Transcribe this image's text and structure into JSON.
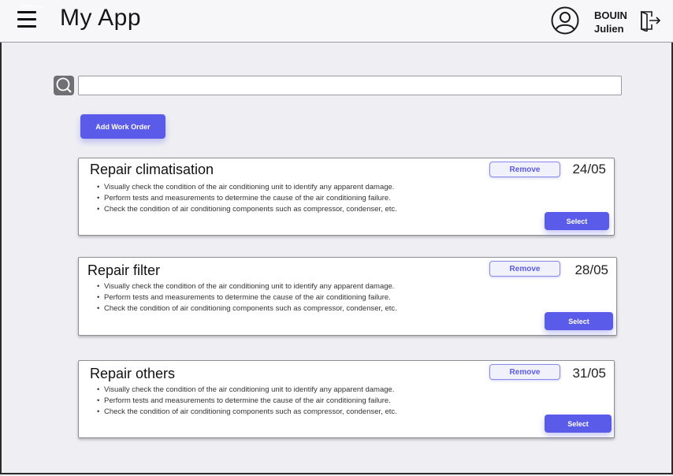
{
  "header": {
    "overlay_label": "Remove",
    "app_title": "My App",
    "user": {
      "last_name": "BOUIN",
      "first_name": "Julien"
    }
  },
  "search": {
    "value": "",
    "placeholder": ""
  },
  "actions": {
    "add_label": "Add Work Order"
  },
  "work_orders": [
    {
      "title": "Repair climatisation",
      "date": "24/05",
      "remove_label": "Remove",
      "select_label": "Select",
      "tasks": [
        "Visually check the condition of the air conditioning unit to identify any apparent damage.",
        "Perform tests and measurements to determine the cause of the air conditioning failure.",
        "Check the condition of air conditioning components such as compressor, condenser, etc."
      ]
    },
    {
      "title": "Repair filter",
      "date": "28/05",
      "remove_label": "Remove",
      "select_label": "Select",
      "tasks": [
        "Visually check the condition of the air conditioning unit to identify any apparent damage.",
        "Perform tests and measurements to determine the cause of the air conditioning failure.",
        "Check the condition of air conditioning components such as compressor, condenser, etc."
      ]
    },
    {
      "title": "Repair others",
      "date": "31/05",
      "remove_label": "Remove",
      "select_label": "Select",
      "tasks": [
        "Visually check the condition of the air conditioning unit to identify any apparent damage.",
        "Perform tests and measurements to determine the cause of the air conditioning failure.",
        "Check the condition of air conditioning components such as compressor, condenser, etc."
      ]
    }
  ],
  "icons": {
    "menu": "hamburger-menu-icon",
    "user": "user-avatar-icon",
    "logout": "logout-icon",
    "search": "search-icon"
  },
  "colors": {
    "accent": "#5b5bea",
    "background": "#efeff3"
  }
}
